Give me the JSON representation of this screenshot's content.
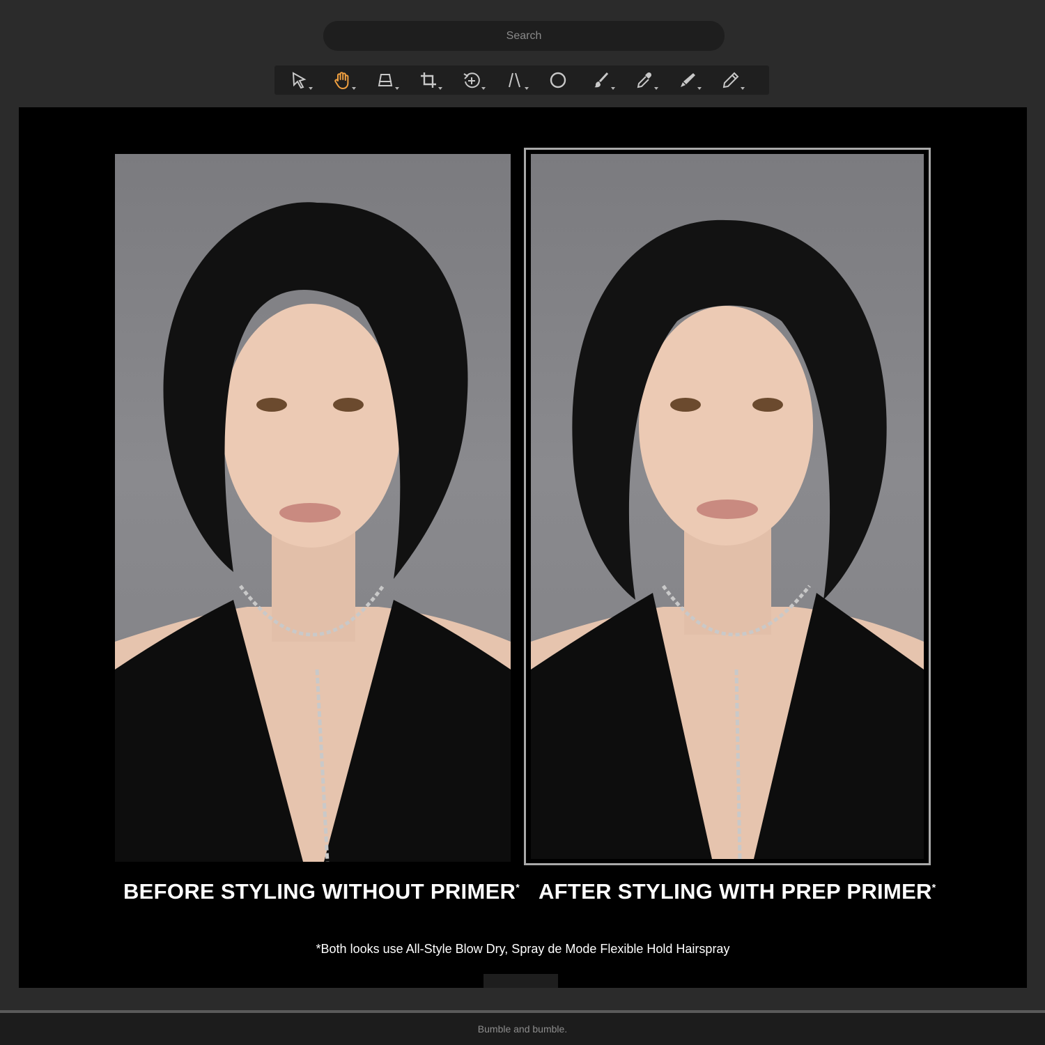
{
  "search": {
    "placeholder": "Search"
  },
  "toolbar": {
    "tools": [
      {
        "name": "select-tool",
        "icon": "arrow-cursor-icon"
      },
      {
        "name": "hand-tool",
        "icon": "hand-icon",
        "active": true
      },
      {
        "name": "perspective-tool",
        "icon": "perspective-icon"
      },
      {
        "name": "crop-tool",
        "icon": "crop-icon"
      },
      {
        "name": "rotate-tool",
        "icon": "rotate-icon"
      },
      {
        "name": "line-tool",
        "icon": "line-icon"
      },
      {
        "name": "ellipse-tool",
        "icon": "circle-icon"
      },
      {
        "name": "brush-tool",
        "icon": "brush-icon"
      },
      {
        "name": "eyedropper-tool",
        "icon": "eyedropper-icon"
      },
      {
        "name": "retouch-tool",
        "icon": "retouch-icon"
      },
      {
        "name": "pencil-tool",
        "icon": "pencil-icon"
      }
    ],
    "active_color": "#f0a040",
    "icon_color": "#c8c8c8"
  },
  "canvas": {
    "before_caption": "BEFORE STYLING WITHOUT PRIMER",
    "after_caption": "AFTER STYLING WITH PREP PRIMER",
    "asterisk": "*",
    "footnote": "*Both looks use All-Style Blow Dry, Spray de Mode Flexible Hold Hairspray"
  },
  "footer": {
    "brand": "Bumble and bumble."
  }
}
